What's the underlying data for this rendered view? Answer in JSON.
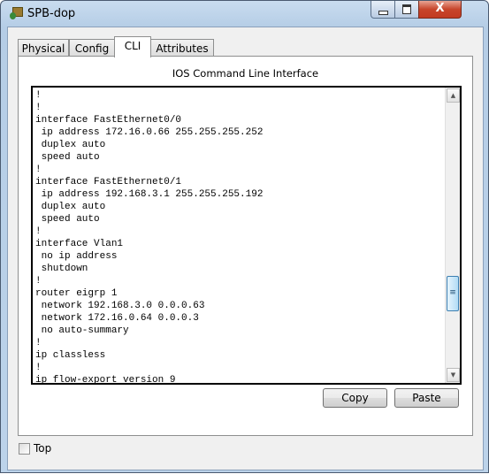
{
  "window": {
    "title": "SPB-dop",
    "close_glyph": "X"
  },
  "tabs": [
    {
      "label": "Physical",
      "active": false
    },
    {
      "label": "Config",
      "active": false
    },
    {
      "label": "CLI",
      "active": true
    },
    {
      "label": "Attributes",
      "active": false
    }
  ],
  "cli": {
    "heading": "IOS Command Line Interface",
    "lines": [
      "!",
      "!",
      "interface FastEthernet0/0",
      " ip address 172.16.0.66 255.255.255.252",
      " duplex auto",
      " speed auto",
      "!",
      "interface FastEthernet0/1",
      " ip address 192.168.3.1 255.255.255.192",
      " duplex auto",
      " speed auto",
      "!",
      "interface Vlan1",
      " no ip address",
      " shutdown",
      "!",
      "router eigrp 1",
      " network 192.168.3.0 0.0.0.63",
      " network 172.16.0.64 0.0.0.3",
      " no auto-summary",
      "!",
      "ip classless",
      "!",
      "ip flow-export version 9"
    ],
    "scroll_position": 0.75
  },
  "buttons": {
    "copy": "Copy",
    "paste": "Paste"
  },
  "top_checkbox": {
    "label": "Top",
    "checked": false
  }
}
